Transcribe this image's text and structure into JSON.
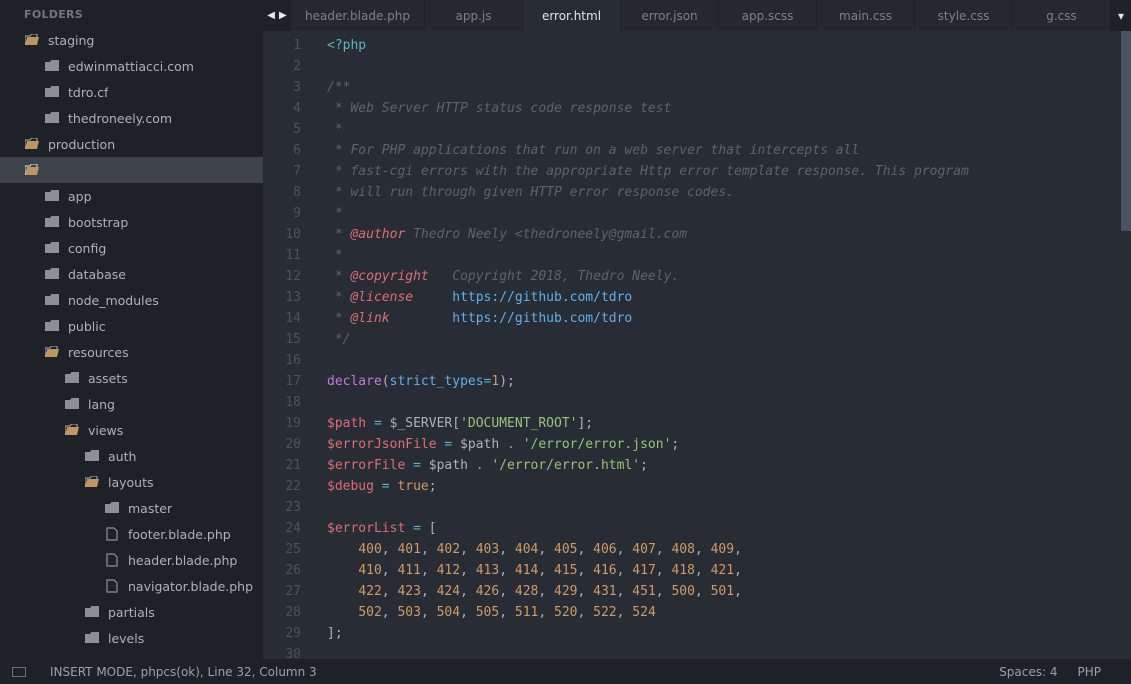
{
  "sidebar": {
    "header": "FOLDERS",
    "items": [
      {
        "label": "staging",
        "kind": "folder",
        "open": true,
        "indent": 0
      },
      {
        "label": "edwinmattiacci.com",
        "kind": "folder",
        "open": false,
        "indent": 1
      },
      {
        "label": "tdro.cf",
        "kind": "folder",
        "open": false,
        "indent": 1
      },
      {
        "label": "thedroneely.com",
        "kind": "folder",
        "open": false,
        "indent": 1
      },
      {
        "label": "production",
        "kind": "folder",
        "open": true,
        "indent": 0
      },
      {
        "label": "",
        "kind": "folder",
        "open": true,
        "indent": 0,
        "selected": true,
        "blur": true
      },
      {
        "label": "app",
        "kind": "folder",
        "open": false,
        "indent": 1
      },
      {
        "label": "bootstrap",
        "kind": "folder",
        "open": false,
        "indent": 1
      },
      {
        "label": "config",
        "kind": "folder",
        "open": false,
        "indent": 1
      },
      {
        "label": "database",
        "kind": "folder",
        "open": false,
        "indent": 1
      },
      {
        "label": "node_modules",
        "kind": "folder",
        "open": false,
        "indent": 1
      },
      {
        "label": "public",
        "kind": "folder",
        "open": false,
        "indent": 1
      },
      {
        "label": "resources",
        "kind": "folder",
        "open": true,
        "indent": 1
      },
      {
        "label": "assets",
        "kind": "folder",
        "open": false,
        "indent": 2
      },
      {
        "label": "lang",
        "kind": "folder",
        "open": false,
        "indent": 2
      },
      {
        "label": "views",
        "kind": "folder",
        "open": true,
        "indent": 2
      },
      {
        "label": "auth",
        "kind": "folder",
        "open": false,
        "indent": 3
      },
      {
        "label": "layouts",
        "kind": "folder",
        "open": true,
        "indent": 3
      },
      {
        "label": "master",
        "kind": "folder",
        "open": false,
        "indent": 4
      },
      {
        "label": "footer.blade.php",
        "kind": "file",
        "open": false,
        "indent": 4
      },
      {
        "label": "header.blade.php",
        "kind": "file",
        "open": false,
        "indent": 4
      },
      {
        "label": "navigator.blade.php",
        "kind": "file",
        "open": false,
        "indent": 4
      },
      {
        "label": "partials",
        "kind": "folder",
        "open": false,
        "indent": 3
      },
      {
        "label": "levels",
        "kind": "folder",
        "open": false,
        "indent": 3
      }
    ]
  },
  "tabs": {
    "items": [
      {
        "label": "header.blade.php",
        "active": false
      },
      {
        "label": "app.js",
        "active": false
      },
      {
        "label": "error.html",
        "active": true
      },
      {
        "label": "error.json",
        "active": false
      },
      {
        "label": "app.scss",
        "active": false
      },
      {
        "label": "main.css",
        "active": false
      },
      {
        "label": "style.css",
        "active": false
      },
      {
        "label": "g.css",
        "active": false
      }
    ]
  },
  "code": {
    "lines": [
      [
        {
          "t": "<?php",
          "c": "c-op"
        }
      ],
      [],
      [
        {
          "t": "/**",
          "c": "c-com"
        }
      ],
      [
        {
          "t": " * Web Server HTTP status code response test",
          "c": "c-com"
        }
      ],
      [
        {
          "t": " *",
          "c": "c-com"
        }
      ],
      [
        {
          "t": " * For PHP applications that run on a web server that intercepts all",
          "c": "c-com"
        }
      ],
      [
        {
          "t": " * fast-cgi errors with the appropriate Http error template response. This program",
          "c": "c-com"
        }
      ],
      [
        {
          "t": " * will run through given HTTP error response codes.",
          "c": "c-com"
        }
      ],
      [
        {
          "t": " *",
          "c": "c-com"
        }
      ],
      [
        {
          "t": " * ",
          "c": "c-com"
        },
        {
          "t": "@author",
          "c": "c-tag"
        },
        {
          "t": " Thedro Neely <thedroneely@gmail.com",
          "c": "c-com"
        }
      ],
      [
        {
          "t": " *",
          "c": "c-com"
        }
      ],
      [
        {
          "t": " * ",
          "c": "c-com"
        },
        {
          "t": "@copyright",
          "c": "c-tag"
        },
        {
          "t": "   Copyright 2018, Thedro Neely.",
          "c": "c-com"
        }
      ],
      [
        {
          "t": " * ",
          "c": "c-com"
        },
        {
          "t": "@license",
          "c": "c-tag"
        },
        {
          "t": "     ",
          "c": "c-com"
        },
        {
          "t": "https://github.com/tdro",
          "c": "c-url"
        }
      ],
      [
        {
          "t": " * ",
          "c": "c-com"
        },
        {
          "t": "@link",
          "c": "c-tag"
        },
        {
          "t": "        ",
          "c": "c-com"
        },
        {
          "t": "https://github.com/tdro",
          "c": "c-url"
        }
      ],
      [
        {
          "t": " */",
          "c": "c-com"
        }
      ],
      [],
      [
        {
          "t": "declare",
          "c": "c-kw"
        },
        {
          "t": "(",
          "c": "c-punc"
        },
        {
          "t": "strict_types",
          "c": "c-func"
        },
        {
          "t": "=",
          "c": "c-op"
        },
        {
          "t": "1",
          "c": "c-num"
        },
        {
          "t": ");",
          "c": "c-punc"
        }
      ],
      [],
      [
        {
          "t": "$path",
          "c": "c-var"
        },
        {
          "t": " ",
          "c": ""
        },
        {
          "t": "=",
          "c": "c-op"
        },
        {
          "t": " $_SERVER[",
          "c": "c-punc"
        },
        {
          "t": "'DOCUMENT_ROOT'",
          "c": "c-str"
        },
        {
          "t": "];",
          "c": "c-punc"
        }
      ],
      [
        {
          "t": "$errorJsonFile",
          "c": "c-var"
        },
        {
          "t": " ",
          "c": ""
        },
        {
          "t": "=",
          "c": "c-op"
        },
        {
          "t": " $path ",
          "c": "c-punc"
        },
        {
          "t": ".",
          "c": "c-op"
        },
        {
          "t": " ",
          "c": ""
        },
        {
          "t": "'/error/error.json'",
          "c": "c-str"
        },
        {
          "t": ";",
          "c": "c-punc"
        }
      ],
      [
        {
          "t": "$errorFile",
          "c": "c-var"
        },
        {
          "t": " ",
          "c": ""
        },
        {
          "t": "=",
          "c": "c-op"
        },
        {
          "t": " $path ",
          "c": "c-punc"
        },
        {
          "t": ".",
          "c": "c-op"
        },
        {
          "t": " ",
          "c": ""
        },
        {
          "t": "'/error/error.html'",
          "c": "c-str"
        },
        {
          "t": ";",
          "c": "c-punc"
        }
      ],
      [
        {
          "t": "$debug",
          "c": "c-var"
        },
        {
          "t": " ",
          "c": ""
        },
        {
          "t": "=",
          "c": "c-op"
        },
        {
          "t": " ",
          "c": ""
        },
        {
          "t": "true",
          "c": "c-num"
        },
        {
          "t": ";",
          "c": "c-punc"
        }
      ],
      [],
      [
        {
          "t": "$errorList",
          "c": "c-var"
        },
        {
          "t": " ",
          "c": ""
        },
        {
          "t": "=",
          "c": "c-op"
        },
        {
          "t": " [",
          "c": "c-punc"
        }
      ],
      [
        {
          "t": "    ",
          "c": ""
        },
        {
          "t": "400",
          "c": "c-num"
        },
        {
          "t": ", ",
          "c": "c-punc"
        },
        {
          "t": "401",
          "c": "c-num"
        },
        {
          "t": ", ",
          "c": "c-punc"
        },
        {
          "t": "402",
          "c": "c-num"
        },
        {
          "t": ", ",
          "c": "c-punc"
        },
        {
          "t": "403",
          "c": "c-num"
        },
        {
          "t": ", ",
          "c": "c-punc"
        },
        {
          "t": "404",
          "c": "c-num"
        },
        {
          "t": ", ",
          "c": "c-punc"
        },
        {
          "t": "405",
          "c": "c-num"
        },
        {
          "t": ", ",
          "c": "c-punc"
        },
        {
          "t": "406",
          "c": "c-num"
        },
        {
          "t": ", ",
          "c": "c-punc"
        },
        {
          "t": "407",
          "c": "c-num"
        },
        {
          "t": ", ",
          "c": "c-punc"
        },
        {
          "t": "408",
          "c": "c-num"
        },
        {
          "t": ", ",
          "c": "c-punc"
        },
        {
          "t": "409",
          "c": "c-num"
        },
        {
          "t": ",",
          "c": "c-punc"
        }
      ],
      [
        {
          "t": "    ",
          "c": ""
        },
        {
          "t": "410",
          "c": "c-num"
        },
        {
          "t": ", ",
          "c": "c-punc"
        },
        {
          "t": "411",
          "c": "c-num"
        },
        {
          "t": ", ",
          "c": "c-punc"
        },
        {
          "t": "412",
          "c": "c-num"
        },
        {
          "t": ", ",
          "c": "c-punc"
        },
        {
          "t": "413",
          "c": "c-num"
        },
        {
          "t": ", ",
          "c": "c-punc"
        },
        {
          "t": "414",
          "c": "c-num"
        },
        {
          "t": ", ",
          "c": "c-punc"
        },
        {
          "t": "415",
          "c": "c-num"
        },
        {
          "t": ", ",
          "c": "c-punc"
        },
        {
          "t": "416",
          "c": "c-num"
        },
        {
          "t": ", ",
          "c": "c-punc"
        },
        {
          "t": "417",
          "c": "c-num"
        },
        {
          "t": ", ",
          "c": "c-punc"
        },
        {
          "t": "418",
          "c": "c-num"
        },
        {
          "t": ", ",
          "c": "c-punc"
        },
        {
          "t": "421",
          "c": "c-num"
        },
        {
          "t": ",",
          "c": "c-punc"
        }
      ],
      [
        {
          "t": "    ",
          "c": ""
        },
        {
          "t": "422",
          "c": "c-num"
        },
        {
          "t": ", ",
          "c": "c-punc"
        },
        {
          "t": "423",
          "c": "c-num"
        },
        {
          "t": ", ",
          "c": "c-punc"
        },
        {
          "t": "424",
          "c": "c-num"
        },
        {
          "t": ", ",
          "c": "c-punc"
        },
        {
          "t": "426",
          "c": "c-num"
        },
        {
          "t": ", ",
          "c": "c-punc"
        },
        {
          "t": "428",
          "c": "c-num"
        },
        {
          "t": ", ",
          "c": "c-punc"
        },
        {
          "t": "429",
          "c": "c-num"
        },
        {
          "t": ", ",
          "c": "c-punc"
        },
        {
          "t": "431",
          "c": "c-num"
        },
        {
          "t": ", ",
          "c": "c-punc"
        },
        {
          "t": "451",
          "c": "c-num"
        },
        {
          "t": ", ",
          "c": "c-punc"
        },
        {
          "t": "500",
          "c": "c-num"
        },
        {
          "t": ", ",
          "c": "c-punc"
        },
        {
          "t": "501",
          "c": "c-num"
        },
        {
          "t": ",",
          "c": "c-punc"
        }
      ],
      [
        {
          "t": "    ",
          "c": ""
        },
        {
          "t": "502",
          "c": "c-num"
        },
        {
          "t": ", ",
          "c": "c-punc"
        },
        {
          "t": "503",
          "c": "c-num"
        },
        {
          "t": ", ",
          "c": "c-punc"
        },
        {
          "t": "504",
          "c": "c-num"
        },
        {
          "t": ", ",
          "c": "c-punc"
        },
        {
          "t": "505",
          "c": "c-num"
        },
        {
          "t": ", ",
          "c": "c-punc"
        },
        {
          "t": "511",
          "c": "c-num"
        },
        {
          "t": ", ",
          "c": "c-punc"
        },
        {
          "t": "520",
          "c": "c-num"
        },
        {
          "t": ", ",
          "c": "c-punc"
        },
        {
          "t": "522",
          "c": "c-num"
        },
        {
          "t": ", ",
          "c": "c-punc"
        },
        {
          "t": "524",
          "c": "c-num"
        }
      ],
      [
        {
          "t": "];",
          "c": "c-punc"
        }
      ],
      []
    ]
  },
  "status": {
    "left": "INSERT MODE, phpcs(ok), Line 32, Column 3",
    "spaces": "Spaces: 4",
    "syntax": "PHP"
  }
}
